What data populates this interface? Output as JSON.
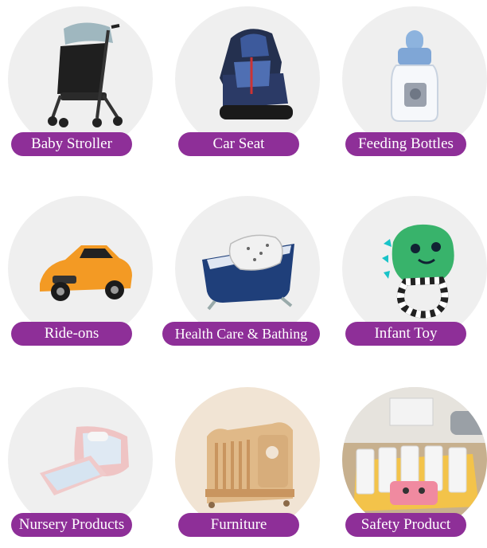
{
  "categories": [
    {
      "label": "Baby Stroller",
      "image": "stroller-image"
    },
    {
      "label": "Car Seat",
      "image": "car-seat-image"
    },
    {
      "label": "Feeding Bottles",
      "image": "feeding-bottle-image"
    },
    {
      "label": "Ride-ons",
      "image": "ride-on-car-image"
    },
    {
      "label": "Health Care & Bathing",
      "image": "baby-bathtub-image"
    },
    {
      "label": "Infant Toy",
      "image": "teether-toy-image"
    },
    {
      "label": "Nursery Products",
      "image": "baby-nest-image"
    },
    {
      "label": "Furniture",
      "image": "crib-image"
    },
    {
      "label": "Safety Product",
      "image": "playpen-image"
    }
  ],
  "colors": {
    "pill": "#8e2f98",
    "circle": "#efefef",
    "label_text": "#ffffff"
  }
}
